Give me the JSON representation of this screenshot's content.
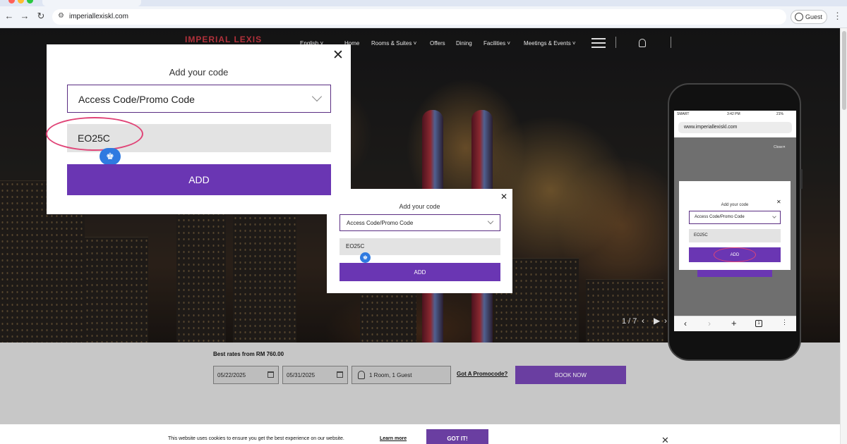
{
  "browser": {
    "url": "imperiallexiskl.com",
    "profile_label": "Guest"
  },
  "site": {
    "logo": "IMPERIAL LEXIS",
    "language": "English",
    "nav": [
      "Home",
      "Rooms & Suites",
      "Offers",
      "Dining",
      "Facilities",
      "Meetings & Events"
    ]
  },
  "slider": {
    "counter": "1 / 7"
  },
  "booking": {
    "best_rates": "Best rates from RM 760.00",
    "check_in": "05/22/2025",
    "check_out": "05/31/2025",
    "rooms_guests": "1 Room, 1 Guest",
    "promo_link": "Got A Promocode?",
    "book_now": "BOOK NOW"
  },
  "cookie": {
    "text": "This website uses cookies to ensure you get the best experience on our website.",
    "learn_more": "Learn more",
    "got_it": "GOT IT!"
  },
  "zoom_dialog": {
    "title": "Add your code",
    "select_value": "Access Code/Promo Code",
    "code_value": "EO25C",
    "add_label": "ADD"
  },
  "desktop_dialog": {
    "title": "Add your code",
    "select_value": "Access Code/Promo Code",
    "code_value": "EO25C",
    "add_label": "ADD"
  },
  "phone": {
    "carrier": "SMART",
    "time": "3:42 PM",
    "battery": "21%",
    "url": "www.imperiallexiskl.com",
    "close_label": "Close",
    "dialog": {
      "title": "Add your code",
      "select_value": "Access Code/Promo Code",
      "code_value": "EO25C",
      "add_label": "ADD"
    },
    "tab_count": "1"
  }
}
